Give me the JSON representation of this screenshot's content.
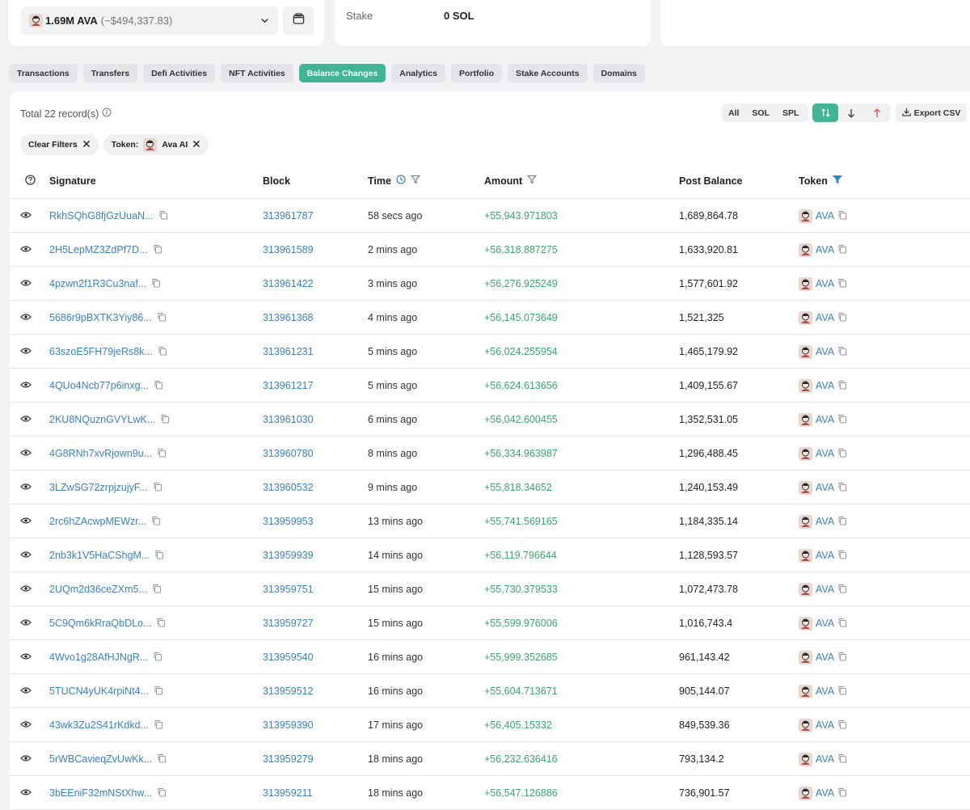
{
  "wallet": {
    "token_amount": "1.69M AVA",
    "token_usd": "(~$494,337.83)"
  },
  "stake": {
    "label": "Stake",
    "value": "0 SOL"
  },
  "tabs": [
    {
      "label": "Transactions"
    },
    {
      "label": "Transfers"
    },
    {
      "label": "Defi Activities"
    },
    {
      "label": "NFT Activities"
    },
    {
      "label": "Balance Changes",
      "active": true
    },
    {
      "label": "Analytics"
    },
    {
      "label": "Portfolio"
    },
    {
      "label": "Stake Accounts"
    },
    {
      "label": "Domains"
    }
  ],
  "toolbar": {
    "total_records": "Total 22 record(s)",
    "filter_all": "All",
    "filter_sol": "SOL",
    "filter_spl": "SPL",
    "export_label": "Export CSV"
  },
  "chips": {
    "clear_filters": "Clear Filters",
    "token_prefix": "Token:",
    "token_name": "Ava AI"
  },
  "columns": {
    "signature": "Signature",
    "block": "Block",
    "time": "Time",
    "amount": "Amount",
    "post_balance": "Post Balance",
    "token": "Token"
  },
  "rows": [
    {
      "signature": "RkhSQhG8fjGzUuaN...",
      "block": "313961787",
      "time": "58 secs ago",
      "amount": "+55,943.971803",
      "post_balance": "1,689,864.78",
      "token": "AVA"
    },
    {
      "signature": "2H5LepMZ3ZdPf7D...",
      "block": "313961589",
      "time": "2 mins ago",
      "amount": "+56,318.887275",
      "post_balance": "1,633,920.81",
      "token": "AVA"
    },
    {
      "signature": "4pzwn2f1R3Cu3naf...",
      "block": "313961422",
      "time": "3 mins ago",
      "amount": "+56,276.925249",
      "post_balance": "1,577,601.92",
      "token": "AVA"
    },
    {
      "signature": "5686r9pBXTK3Yiy86...",
      "block": "313961368",
      "time": "4 mins ago",
      "amount": "+56,145.073649",
      "post_balance": "1,521,325",
      "token": "AVA"
    },
    {
      "signature": "63szoE5FH79jeRs8k...",
      "block": "313961231",
      "time": "5 mins ago",
      "amount": "+56,024.255954",
      "post_balance": "1,465,179.92",
      "token": "AVA"
    },
    {
      "signature": "4QUo4Ncb77p6inxg...",
      "block": "313961217",
      "time": "5 mins ago",
      "amount": "+56,624.613656",
      "post_balance": "1,409,155.67",
      "token": "AVA"
    },
    {
      "signature": "2KU8NQuznGVYLwK...",
      "block": "313961030",
      "time": "6 mins ago",
      "amount": "+56,042.600455",
      "post_balance": "1,352,531.05",
      "token": "AVA"
    },
    {
      "signature": "4G8RNh7xvRjown9u...",
      "block": "313960780",
      "time": "8 mins ago",
      "amount": "+56,334.963987",
      "post_balance": "1,296,488.45",
      "token": "AVA"
    },
    {
      "signature": "3LZwSG72zrpjzujyF...",
      "block": "313960532",
      "time": "9 mins ago",
      "amount": "+55,818.34652",
      "post_balance": "1,240,153.49",
      "token": "AVA"
    },
    {
      "signature": "2rc6hZAcwpMEWzr...",
      "block": "313959953",
      "time": "13 mins ago",
      "amount": "+55,741.569165",
      "post_balance": "1,184,335.14",
      "token": "AVA"
    },
    {
      "signature": "2nb3k1V5HaCShgM...",
      "block": "313959939",
      "time": "14 mins ago",
      "amount": "+56,119.796644",
      "post_balance": "1,128,593.57",
      "token": "AVA"
    },
    {
      "signature": "2UQm2d36ceZXm5...",
      "block": "313959751",
      "time": "15 mins ago",
      "amount": "+55,730.379533",
      "post_balance": "1,072,473.78",
      "token": "AVA"
    },
    {
      "signature": "5C9Qm6kRraQbDLo...",
      "block": "313959727",
      "time": "15 mins ago",
      "amount": "+55,599.976006",
      "post_balance": "1,016,743.4",
      "token": "AVA"
    },
    {
      "signature": "4Wvo1g28AfHJNgR...",
      "block": "313959540",
      "time": "16 mins ago",
      "amount": "+55,999.352685",
      "post_balance": "961,143.42",
      "token": "AVA"
    },
    {
      "signature": "5TUCN4yUK4rpiNt4...",
      "block": "313959512",
      "time": "16 mins ago",
      "amount": "+55,604.713671",
      "post_balance": "905,144.07",
      "token": "AVA"
    },
    {
      "signature": "43wk3Zu2S41rKdkd...",
      "block": "313959390",
      "time": "17 mins ago",
      "amount": "+56,405.15332",
      "post_balance": "849,539.36",
      "token": "AVA"
    },
    {
      "signature": "5rWBCavieqZvUwKk...",
      "block": "313959279",
      "time": "18 mins ago",
      "amount": "+56,232.636416",
      "post_balance": "793,134.2",
      "token": "AVA"
    },
    {
      "signature": "3bEEniF32mNStXhw...",
      "block": "313959211",
      "time": "18 mins ago",
      "amount": "+56,547.126886",
      "post_balance": "736,901.57",
      "token": "AVA"
    }
  ],
  "colors": {
    "accent": "#3fb592",
    "link": "#3b82c4",
    "positive": "#3aa76d",
    "filter_icon_active": "#3b82c4"
  },
  "icons": {
    "token_avatar": "ava-token-avatar",
    "view": "eye-icon",
    "copy": "copy-icon"
  }
}
